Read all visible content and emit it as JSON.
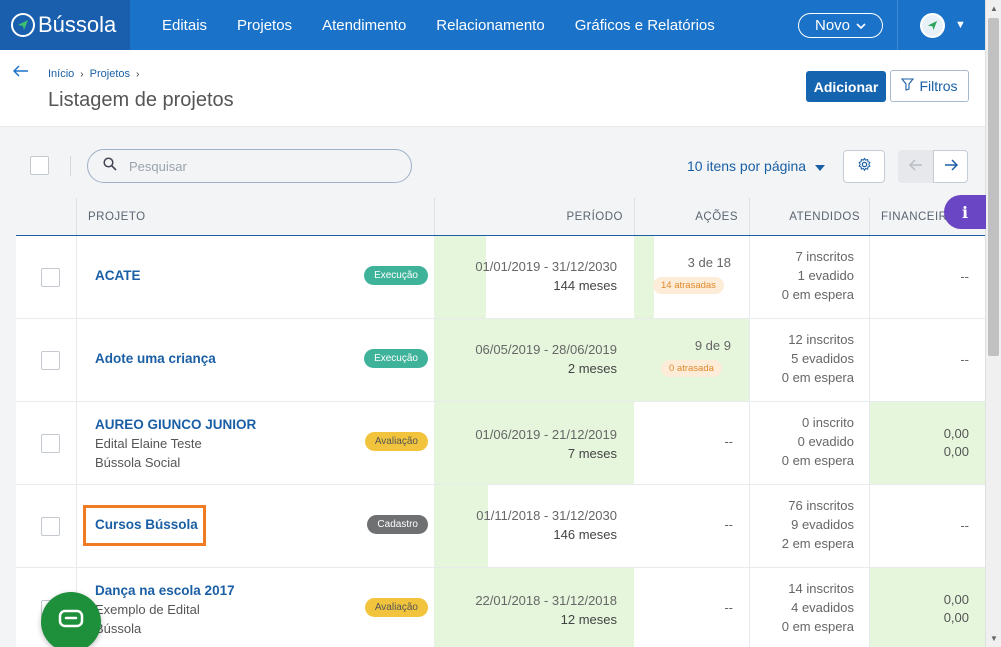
{
  "brand": {
    "name": "Bússola"
  },
  "nav": {
    "items": [
      "Editais",
      "Projetos",
      "Atendimento",
      "Relacionamento",
      "Gráficos e Relatórios"
    ],
    "novo_label": "Novo"
  },
  "breadcrumb": {
    "items": [
      "Início",
      "Projetos"
    ]
  },
  "page": {
    "title": "Listagem de projetos"
  },
  "actions": {
    "add_label": "Adicionar",
    "filter_label": "Filtros"
  },
  "search": {
    "placeholder": "Pesquisar"
  },
  "pagination": {
    "per_page_label": "10 itens por página"
  },
  "table": {
    "headers": {
      "projeto": "PROJETO",
      "periodo": "PERÍODO",
      "acoes": "AÇÕES",
      "atendidos": "ATENDIDOS",
      "financeiro": "FINANCEIRO"
    },
    "rows": [
      {
        "name": "ACATE",
        "sub1": "",
        "sub2": "",
        "status": "Execução",
        "period": "01/01/2019 - 31/12/2030",
        "months": "144 meses",
        "acoes": "3 de 18",
        "late": "14 atrasadas",
        "inscritos": "7 inscritos",
        "evadidos": "1 evadido",
        "espera": "0 em espera",
        "fin1": "--",
        "fin2": ""
      },
      {
        "name": "Adote uma criança",
        "sub1": "",
        "sub2": "",
        "status": "Execução",
        "period": "06/05/2019 - 28/06/2019",
        "months": "2 meses",
        "acoes": "9 de 9",
        "late": "0 atrasada",
        "inscritos": "12 inscritos",
        "evadidos": "5 evadidos",
        "espera": "0 em espera",
        "fin1": "--",
        "fin2": ""
      },
      {
        "name": "AUREO GIUNCO JUNIOR",
        "sub1": "Edital Elaine Teste",
        "sub2": "Bússola Social",
        "status": "Avaliação",
        "period": "01/06/2019 - 21/12/2019",
        "months": "7 meses",
        "acoes": "--",
        "late": "",
        "inscritos": "0 inscrito",
        "evadidos": "0 evadido",
        "espera": "0 em espera",
        "fin1": "0,00",
        "fin2": "0,00"
      },
      {
        "name": "Cursos Bússola",
        "sub1": "",
        "sub2": "",
        "status": "Cadastro",
        "period": "01/11/2018 - 31/12/2030",
        "months": "146 meses",
        "acoes": "--",
        "late": "",
        "inscritos": "76 inscritos",
        "evadidos": "9 evadidos",
        "espera": "2 em espera",
        "fin1": "--",
        "fin2": ""
      },
      {
        "name": "Dança na escola 2017",
        "sub1": "Exemplo de Edital",
        "sub2": "Bússola",
        "status": "Avaliação",
        "period": "22/01/2018 - 31/12/2018",
        "months": "12 meses",
        "acoes": "--",
        "late": "",
        "inscritos": "14 inscritos",
        "evadidos": "4 evadidos",
        "espera": "0 em espera",
        "fin1": "0,00",
        "fin2": "0,00"
      }
    ]
  },
  "colors": {
    "nav": "#1a72c9",
    "primary": "#1564b0",
    "green_cell": "#e5f6dc",
    "highlight": "#f07b22",
    "info": "#6a45c4",
    "chat": "#1e8f3a"
  },
  "icons": [
    "compass-logo-icon",
    "chevron-down-icon",
    "user-avatar-icon",
    "back-arrow-icon",
    "filter-icon",
    "search-icon",
    "gear-icon",
    "arrow-left-icon",
    "arrow-right-icon",
    "info-icon",
    "chat-icon"
  ]
}
